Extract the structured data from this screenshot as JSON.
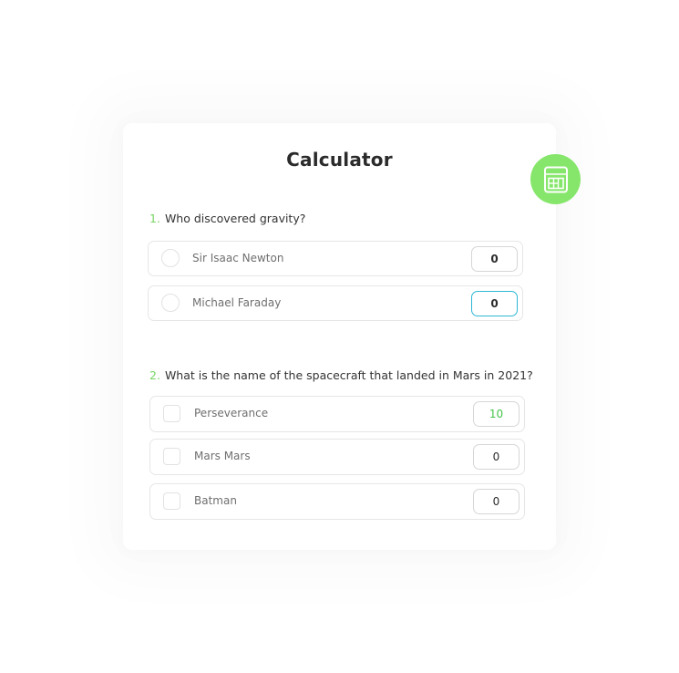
{
  "card": {
    "title": "Calculator",
    "badge_icon": "calculator-icon",
    "accent_color": "#86e66b"
  },
  "questions": [
    {
      "number": "1.",
      "text": "Who discovered gravity?",
      "input_type": "radio",
      "options": [
        {
          "label": "Sir Isaac Newton",
          "score": "0"
        },
        {
          "label": "Michael Faraday",
          "score": "0"
        }
      ]
    },
    {
      "number": "2.",
      "text": "What is the name of the spacecraft that landed in Mars in 2021?",
      "input_type": "checkbox",
      "options": [
        {
          "label": "Perseverance",
          "score": "10"
        },
        {
          "label": "Mars Mars",
          "score": "0"
        },
        {
          "label": "Batman",
          "score": "0"
        }
      ]
    }
  ]
}
